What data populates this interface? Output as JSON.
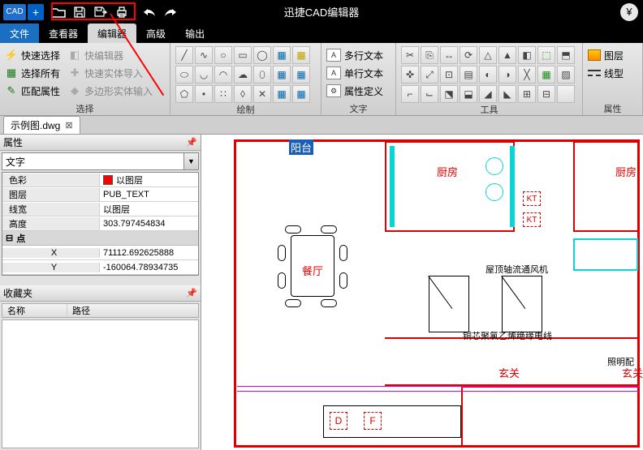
{
  "app": {
    "title": "迅捷CAD编辑器",
    "logo": "CAD"
  },
  "tabs": {
    "file": "文件",
    "viewer": "查看器",
    "editor": "编辑器",
    "advanced": "高级",
    "output": "输出"
  },
  "ribbon": {
    "select": {
      "label": "选择",
      "quick": "快速选择",
      "all": "选择所有",
      "match": "匹配属性",
      "quickEdit": "快编辑器",
      "solidImport": "快速实体导入",
      "polyImport": "多边形实体输入"
    },
    "draw": {
      "label": "绘制"
    },
    "text": {
      "label": "文字",
      "multi": "多行文本",
      "single": "单行文本",
      "attrdef": "属性定义"
    },
    "tools": {
      "label": "工具"
    },
    "props": {
      "label": "属性",
      "layer": "图层",
      "linetype": "线型"
    }
  },
  "doc": {
    "name": "示例图.dwg"
  },
  "propsPanel": {
    "title": "属性",
    "combo": "文字",
    "rows": {
      "color": "色彩",
      "colorVal": "以图层",
      "layer": "图层",
      "layerVal": "PUB_TEXT",
      "lw": "线宽",
      "lwVal": "以图层",
      "height": "高度",
      "heightVal": "303.797454834"
    },
    "pointHead": "点",
    "x": "X",
    "xVal": "71112.692625888",
    "y": "Y",
    "yVal": "-160064.78934735"
  },
  "fav": {
    "title": "收藏夹",
    "name": "名称",
    "path": "路径"
  },
  "rooms": {
    "balcony": "阳台",
    "kitchen": "厨房",
    "dining": "餐厅",
    "fan": "屋顶轴流通风机",
    "cable": "铜芯聚氯乙烯绝缘电线",
    "hall": "玄关",
    "light": "照明配"
  },
  "markers": {
    "kt": "KT",
    "d": "D",
    "f": "F"
  }
}
